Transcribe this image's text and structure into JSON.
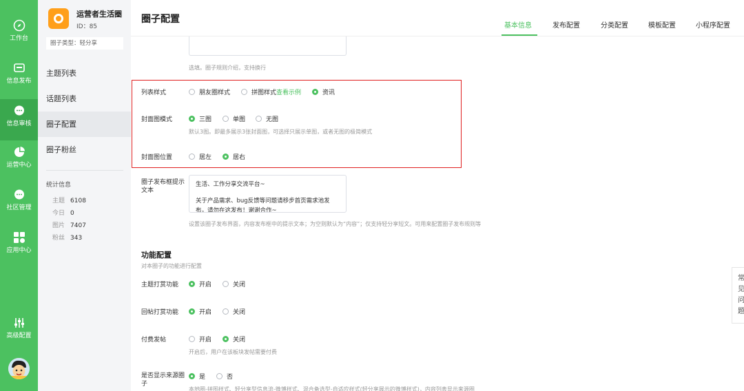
{
  "rail": {
    "items": [
      {
        "label": "工作台",
        "icon": "compass-icon"
      },
      {
        "label": "信息发布",
        "icon": "message-box-icon"
      },
      {
        "label": "信息审核",
        "icon": "chat-bubble-icon"
      },
      {
        "label": "运营中心",
        "icon": "pie-chart-icon"
      },
      {
        "label": "社区管理",
        "icon": "chat-dots-icon"
      },
      {
        "label": "应用中心",
        "icon": "grid-apps-icon"
      },
      {
        "label": "高级配置",
        "icon": "sliders-icon"
      }
    ]
  },
  "sidebar": {
    "circle_name": "运营者生活圈",
    "circle_id": "ID：85",
    "circle_type": "圈子类型：轻分享",
    "nav": [
      "主题列表",
      "话题列表",
      "圈子配置",
      "圈子粉丝"
    ],
    "stats_title": "统计信息",
    "stats": [
      {
        "label": "主题",
        "value": "6108"
      },
      {
        "label": "今日",
        "value": "0"
      },
      {
        "label": "图片",
        "value": "7407"
      },
      {
        "label": "粉丝",
        "value": "343"
      }
    ]
  },
  "header": {
    "title": "圈子配置",
    "tabs": [
      "基本信息",
      "发布配置",
      "分类配置",
      "模板配置",
      "小程序配置"
    ]
  },
  "form": {
    "rules_hint": "选填。圈子规则介绍，支持换行",
    "list_style": {
      "label": "列表样式",
      "opt1": "朋友圈样式",
      "opt2": "拼图样式",
      "opt2_link": "查看示例",
      "opt3": "资讯"
    },
    "cover_mode": {
      "label": "封面图模式",
      "opt1": "三图",
      "opt2": "单图",
      "opt3": "无图",
      "hint": "默认3图。即最多展示3张封面图，可选择只展示单图，或者无图的极简模式"
    },
    "cover_pos": {
      "label": "封面图位置",
      "opt1": "居左",
      "opt2": "居右"
    },
    "prompt": {
      "label": "圈子发布框提示文本",
      "line1": "生活、工作分享交流平台~",
      "line2": "关于产品需求、bug反馈等问题请移步首页需求池发布，请勿在这发布！谢谢合作~",
      "hint": "设置该圈子发布界面，内容发布框中的提示文本；为空则默认为“内容”；仅支持轻分享短文。可用来配置圈子发布规则等"
    },
    "func": {
      "title": "功能配置",
      "sub": "对本圈子的功能进行配置",
      "topic_reward": {
        "label": "主题打赏功能",
        "on": "开启",
        "off": "关闭"
      },
      "reply_reward": {
        "label": "回帖打赏功能",
        "on": "开启",
        "off": "关闭"
      },
      "paid_post": {
        "label": "付费发帖",
        "on": "开启",
        "off": "关闭",
        "hint": "开启后，用户在该板块发帖需要付费"
      },
      "show_source": {
        "label": "是否显示来源圈子",
        "yes": "是",
        "no": "否",
        "hint": "本地圈-拼图样式、轻分享型信息流-微博样式、混合备选型-自适应样式(轻分享展示的微博样式)，内容列表显示来源圈"
      }
    }
  },
  "faq": {
    "chars": [
      "常",
      "见",
      "问",
      "题"
    ]
  }
}
